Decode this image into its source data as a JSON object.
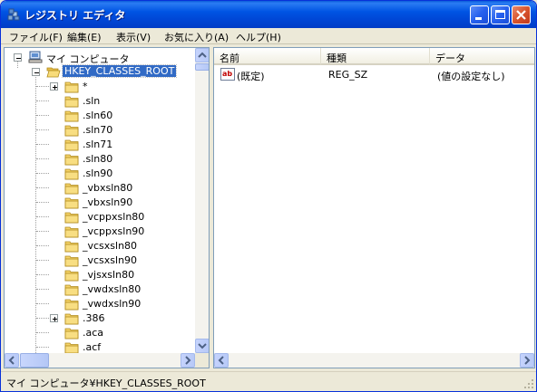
{
  "window": {
    "title": "レジストリ エディタ"
  },
  "menu": [
    {
      "label": "ファイル(F)"
    },
    {
      "label": "編集(E)"
    },
    {
      "label": "表示(V)"
    },
    {
      "label": "お気に入り(A)"
    },
    {
      "label": "ヘルプ(H)"
    }
  ],
  "tree": {
    "root": "マイ コンピュータ",
    "selected": "HKEY_CLASSES_ROOT",
    "items": [
      {
        "label": "*",
        "expandable": true
      },
      {
        "label": ".sln",
        "expandable": false
      },
      {
        "label": ".sln60",
        "expandable": false
      },
      {
        "label": ".sln70",
        "expandable": false
      },
      {
        "label": ".sln71",
        "expandable": false
      },
      {
        "label": ".sln80",
        "expandable": false
      },
      {
        "label": ".sln90",
        "expandable": false
      },
      {
        "label": "_vbxsln80",
        "expandable": false
      },
      {
        "label": "_vbxsln90",
        "expandable": false
      },
      {
        "label": "_vcppxsln80",
        "expandable": false
      },
      {
        "label": "_vcppxsln90",
        "expandable": false
      },
      {
        "label": "_vcsxsln80",
        "expandable": false
      },
      {
        "label": "_vcsxsln90",
        "expandable": false
      },
      {
        "label": "_vjsxsln80",
        "expandable": false
      },
      {
        "label": "_vwdxsln80",
        "expandable": false
      },
      {
        "label": "_vwdxsln90",
        "expandable": false
      },
      {
        "label": ".386",
        "expandable": true
      },
      {
        "label": ".aca",
        "expandable": false
      },
      {
        "label": ".acf",
        "expandable": false
      }
    ]
  },
  "list": {
    "columns": [
      "名前",
      "種類",
      "データ"
    ],
    "rows": [
      {
        "name": "(既定)",
        "type": "REG_SZ",
        "data": "(値の設定なし)",
        "icon": "string-value-icon"
      }
    ]
  },
  "status": {
    "path": "マイ コンピュータ¥HKEY_CLASSES_ROOT"
  },
  "colors": {
    "titlebar": "#0054e3",
    "selection": "#316ac5",
    "folder": "#f5d36a",
    "window_face": "#ece9d8"
  }
}
